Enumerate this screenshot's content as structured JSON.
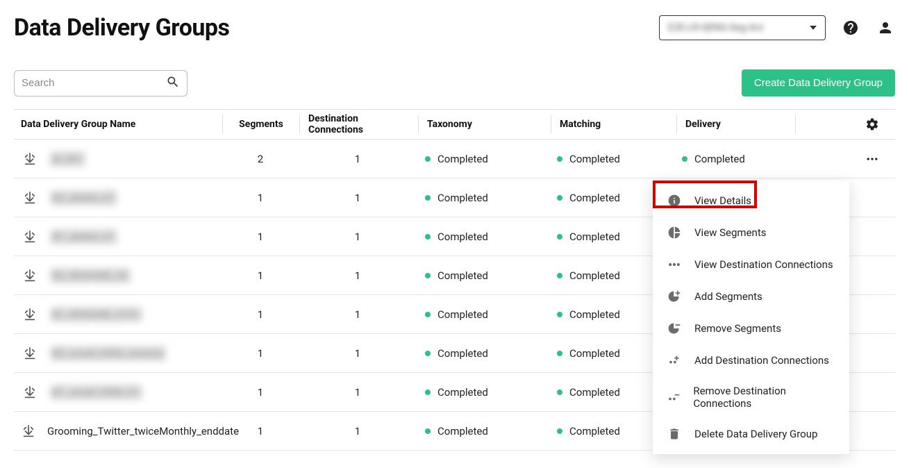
{
  "header": {
    "title": "Data Delivery Groups",
    "account_label": "E2E-LR-QENG-Seg-Act"
  },
  "toolbar": {
    "search_placeholder": "Search",
    "create_label": "Create Data Delivery Group"
  },
  "columns": {
    "name": "Data Delivery Group Name",
    "segments": "Segments",
    "destinations": "Destination Connections",
    "taxonomy": "Taxonomy",
    "matching": "Matching",
    "delivery": "Delivery"
  },
  "status": {
    "completed": "Completed"
  },
  "rows": [
    {
      "name": "jk_001",
      "blurred": true,
      "segments": "2",
      "destinations": "1",
      "taxonomy": "Completed",
      "matching": "Completed",
      "delivery": "Completed",
      "show_actions": true
    },
    {
      "name": "B2_delete_01",
      "blurred": true,
      "segments": "1",
      "destinations": "1",
      "taxonomy": "Completed",
      "matching": "Completed",
      "delivery": ""
    },
    {
      "name": "B1_delete_01",
      "blurred": true,
      "segments": "1",
      "destinations": "1",
      "taxonomy": "Completed",
      "matching": "Completed",
      "delivery": ""
    },
    {
      "name": "B2_RENAME_02",
      "blurred": true,
      "segments": "1",
      "destinations": "1",
      "taxonomy": "Completed",
      "matching": "Completed",
      "delivery": ""
    },
    {
      "name": "B1_RENAME_0101",
      "blurred": true,
      "segments": "1",
      "destinations": "1",
      "taxonomy": "Completed",
      "matching": "Completed",
      "delivery": ""
    },
    {
      "name": "B2_small_0506_rename",
      "blurred": true,
      "segments": "1",
      "destinations": "1",
      "taxonomy": "Completed",
      "matching": "Completed",
      "delivery": ""
    },
    {
      "name": "B1_small_0506_01",
      "blurred": true,
      "segments": "1",
      "destinations": "1",
      "taxonomy": "Completed",
      "matching": "Completed",
      "delivery": ""
    },
    {
      "name": "Grooming_Twitter_twiceMonthly_enddate",
      "blurred": false,
      "segments": "1",
      "destinations": "1",
      "taxonomy": "Completed",
      "matching": "Completed",
      "delivery": "Completed"
    }
  ],
  "menu": {
    "view_details": "View Details",
    "view_segments": "View Segments",
    "view_destinations": "View Destination Connections",
    "add_segments": "Add Segments",
    "remove_segments": "Remove Segments",
    "add_destinations": "Add Destination Connections",
    "remove_destinations": "Remove Destination Connections",
    "delete_group": "Delete Data Delivery Group"
  }
}
